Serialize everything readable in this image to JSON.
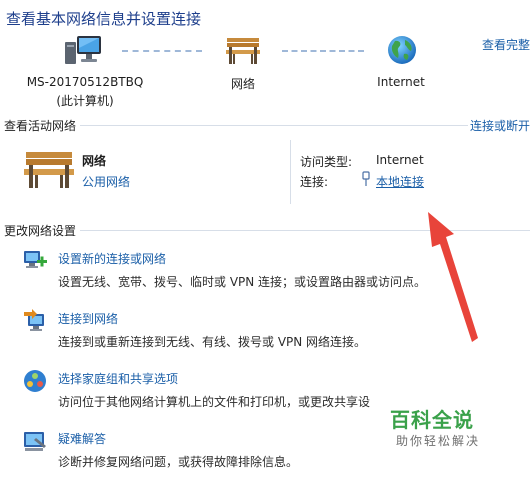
{
  "header": {
    "title": "查看基本网络信息并设置连接",
    "view_full_map": "查看完整"
  },
  "network_map": {
    "computer": {
      "name": "MS-20170512BTBQ",
      "subtitle": "(此计算机)",
      "icon": "computer-icon"
    },
    "network": {
      "name": "网络",
      "icon": "park-bench-icon"
    },
    "internet": {
      "name": "Internet",
      "icon": "globe-icon"
    }
  },
  "active_networks": {
    "section_title": "查看活动网络",
    "connect_disconnect": "连接或断开",
    "network_name": "网络",
    "network_type": "公用网络",
    "access_type_label": "访问类型:",
    "access_type_value": "Internet",
    "connection_label": "连接:",
    "connection_value": "本地连接"
  },
  "change_settings": {
    "section_title": "更改网络设置",
    "items": [
      {
        "title": "设置新的连接或网络",
        "desc": "设置无线、宽带、拨号、临时或 VPN 连接；或设置路由器或访问点。",
        "icon": "new-connection-icon"
      },
      {
        "title": "连接到网络",
        "desc": "连接到或重新连接到无线、有线、拨号或 VPN 网络连接。",
        "icon": "connect-network-icon"
      },
      {
        "title": "选择家庭组和共享选项",
        "desc": "访问位于其他网络计算机上的文件和打印机，或更改共享设",
        "icon": "homegroup-icon"
      },
      {
        "title": "疑难解答",
        "desc": "诊断并修复网络问题，或获得故障排除信息。",
        "icon": "troubleshoot-icon"
      }
    ]
  },
  "watermark": {
    "main": "百科全说",
    "sub": "助你轻松解决"
  },
  "colors": {
    "link": "#1b5fa8",
    "title": "#1e3f8c",
    "arrow": "#e8443a",
    "watermark": "#3aa14a"
  }
}
